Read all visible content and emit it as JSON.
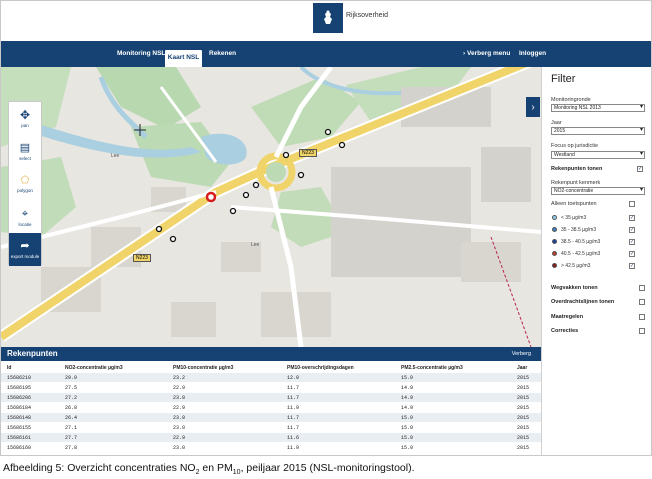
{
  "banner": {
    "brand": "Rijksoverheid"
  },
  "nav": {
    "items": [
      "Monitoring NSL",
      "Kaart NSL",
      "Rekenen"
    ],
    "active": "Kaart NSL",
    "menu": "Verberg menu",
    "login": "Inloggen"
  },
  "map": {
    "tools": [
      "pan",
      "select",
      "polygon",
      "locatie",
      "export module"
    ],
    "road_labels": [
      "N223",
      "N223",
      "Lee",
      "Lee"
    ]
  },
  "filter": {
    "title": "Filter",
    "monitoringronde_label": "Monitoringronde",
    "monitoringronde_value": "Monitoring NSL 2013",
    "jaar_label": "Jaar",
    "jaar_value": "2015",
    "focus_label": "Focus op jurisdictie",
    "focus_value": "Westland",
    "rekenpunten_tonen": "Rekenpunten tonen",
    "kenmerk_label": "Rekenpunt kenmerk",
    "kenmerk_value": "NO2-concentratie",
    "alleen_toetspunten": "Alleen toetspunten",
    "legend": [
      {
        "label": "< 35 µg/m3",
        "color": "#8fd1e8"
      },
      {
        "label": "35 - 38.5 µg/m3",
        "color": "#3a7fc4"
      },
      {
        "label": "38.5 - 40.5 µg/m3",
        "color": "#1f3d99"
      },
      {
        "label": "40.5 - 42.5 µg/m3",
        "color": "#c0392b"
      },
      {
        "label": "> 42.5 µg/m3",
        "color": "#8b1a1a"
      }
    ],
    "wegvakken": "Wegvakken tonen",
    "overdrachtslijnen": "Overdrachtslijnen tonen",
    "maatregelen": "Maatregelen",
    "correcties": "Correcties"
  },
  "table": {
    "title": "Rekenpunten",
    "link": "Verberg",
    "columns": [
      "Id",
      "NO2-concentratie µg/m3",
      "PM10-concentratie µg/m3",
      "PM10-overschrijdingsdagen",
      "PM2.5-concentratie µg/m3",
      "Jaar"
    ],
    "rows": [
      [
        "15686210",
        "29.0",
        "23.2",
        "12.0",
        "15.0",
        "2015"
      ],
      [
        "15686195",
        "27.5",
        "22.9",
        "11.7",
        "14.9",
        "2015"
      ],
      [
        "15686206",
        "27.2",
        "23.0",
        "11.7",
        "14.9",
        "2015"
      ],
      [
        "15686184",
        "26.8",
        "22.9",
        "11.9",
        "14.9",
        "2015"
      ],
      [
        "15686148",
        "26.4",
        "23.0",
        "11.7",
        "15.0",
        "2015"
      ],
      [
        "15686155",
        "27.1",
        "23.0",
        "11.7",
        "15.0",
        "2015"
      ],
      [
        "15686161",
        "27.7",
        "22.9",
        "11.6",
        "15.0",
        "2015"
      ],
      [
        "15686160",
        "27.8",
        "23.0",
        "11.9",
        "15.0",
        "2015"
      ]
    ]
  },
  "caption": {
    "pre": "Afbeelding 5: Overzicht concentraties NO",
    "sub1": "2",
    "mid": " en PM",
    "sub2": "10",
    "post": ", peiljaar 2015 (NSL-monitoringstool)."
  }
}
